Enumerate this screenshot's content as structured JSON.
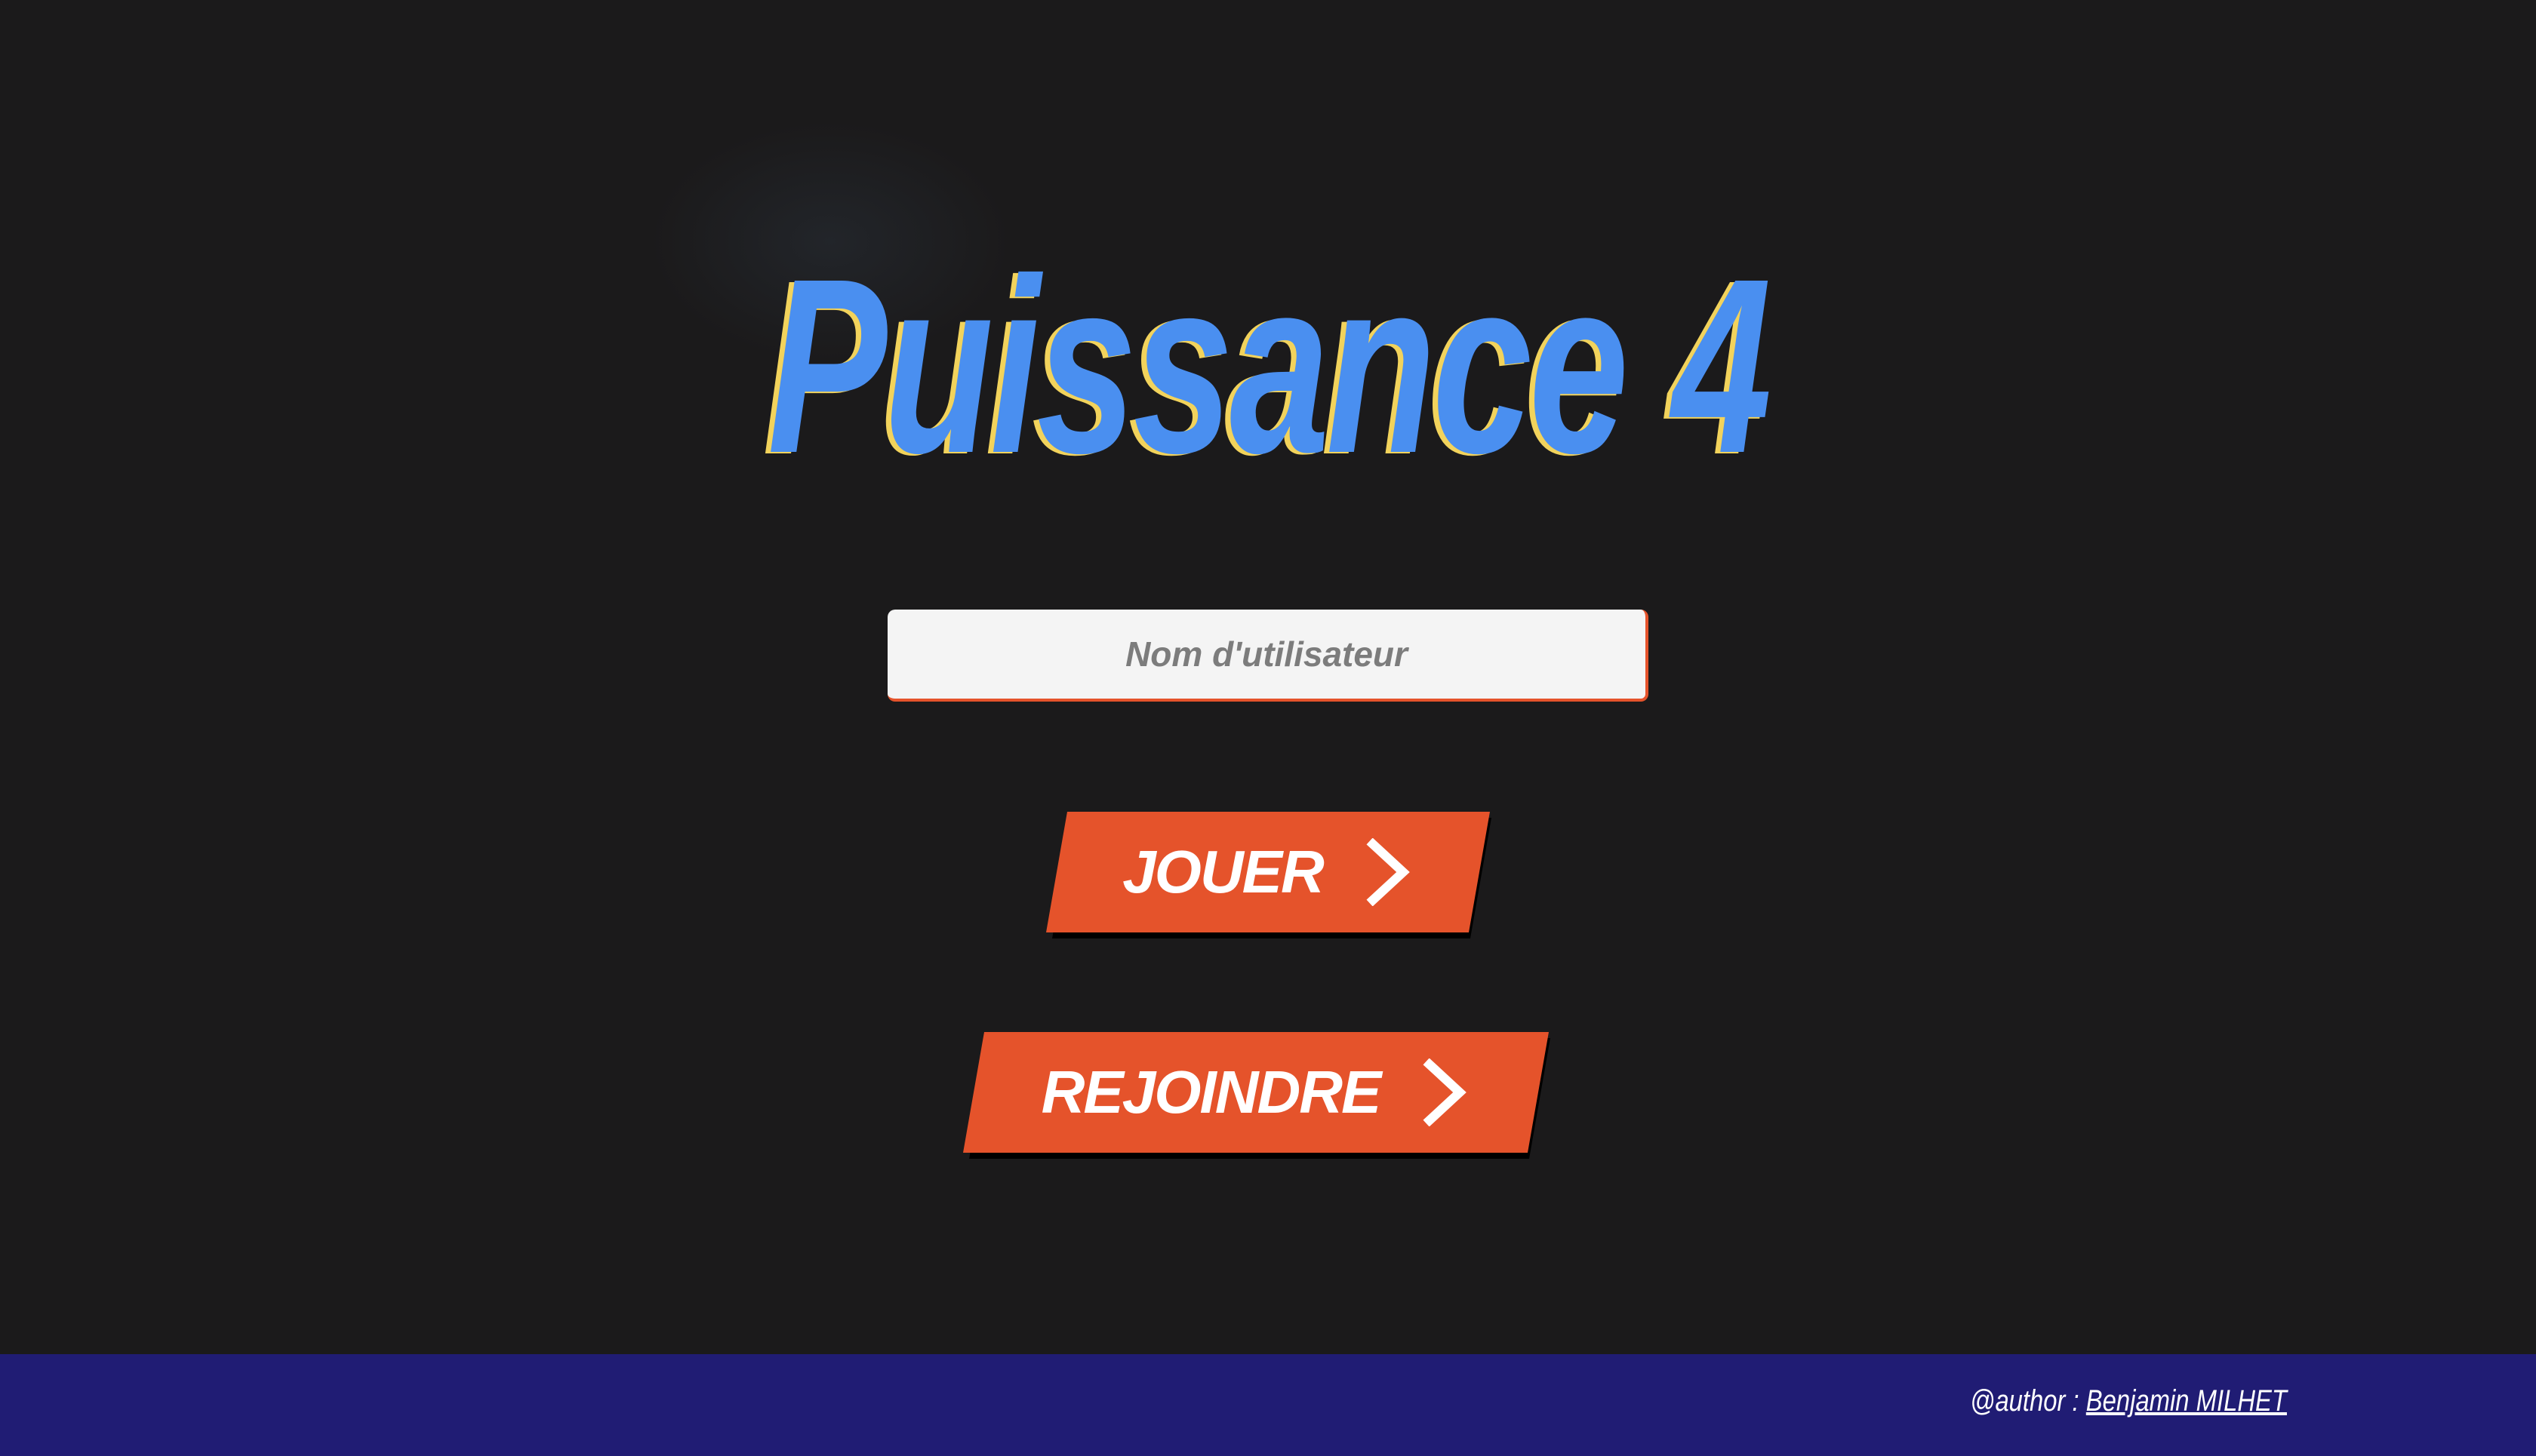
{
  "title": "Puissance 4",
  "username_input": {
    "placeholder": "Nom d'utilisateur",
    "value": ""
  },
  "buttons": {
    "play": "JOUER",
    "join": "REJOINDRE"
  },
  "footer": {
    "author_prefix": "@author :",
    "author_name": "Benjamin MILHET"
  },
  "colors": {
    "background": "#1b1a1b",
    "title": "#4a8ff0",
    "title_shadow": "#f2d35c",
    "button": "#e5532b",
    "footer": "#201c74"
  },
  "icons": {
    "play_button_icon": "chevron-right",
    "join_button_icon": "chevron-right"
  }
}
